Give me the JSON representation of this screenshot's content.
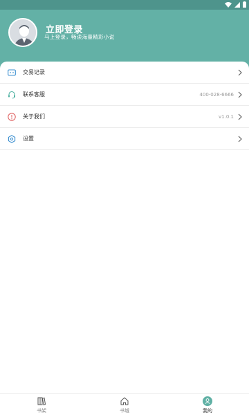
{
  "colors": {
    "status_bar": "#4e948c",
    "header": "#63b1a6",
    "accent": "#5fb0a4",
    "icon_blue": "#3b8fd0",
    "icon_green": "#4fb2a2",
    "icon_red": "#e06666"
  },
  "header": {
    "title": "立即登录",
    "subtitle": "马上登录，畅读海量精彩小说"
  },
  "menu": [
    {
      "label": "交易记录",
      "value": "",
      "icon": "transaction-icon"
    },
    {
      "label": "联系客服",
      "value": "400-028-6666",
      "icon": "headset-icon"
    },
    {
      "label": "关于我们",
      "value": "v1.0.1",
      "icon": "info-icon"
    },
    {
      "label": "设置",
      "value": "",
      "icon": "settings-hex-icon"
    }
  ],
  "tabs": [
    {
      "label": "书架",
      "icon": "bookshelf-icon",
      "active": false
    },
    {
      "label": "书城",
      "icon": "home-icon",
      "active": false
    },
    {
      "label": "我的",
      "icon": "profile-icon",
      "active": true
    }
  ]
}
